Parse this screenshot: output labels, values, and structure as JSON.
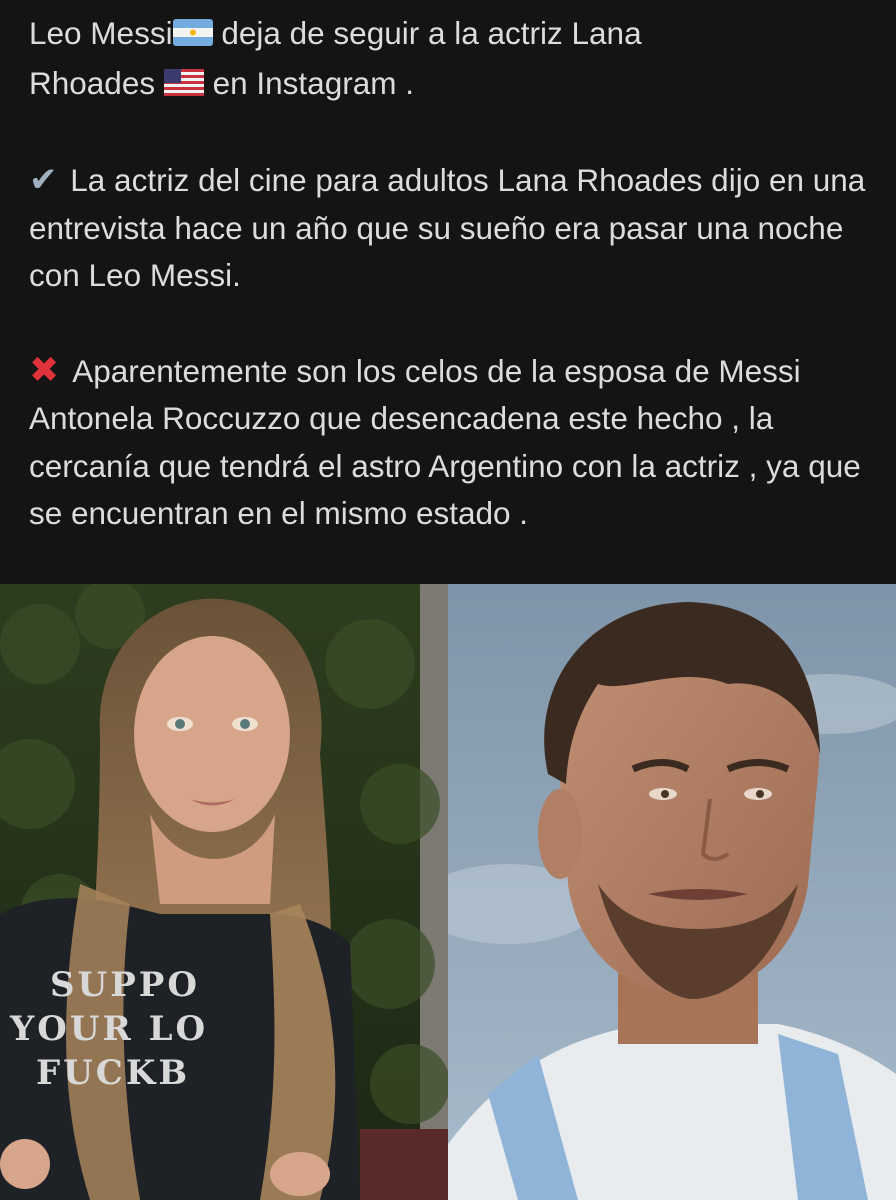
{
  "post": {
    "line1_a": "Leo Messi",
    "line1_b": " deja de seguir a la actriz Lana",
    "line2_a": "Rhoades ",
    "line2_b": " en Instagram .",
    "para2": "La actriz del cine para adultos Lana Rhoades dijo en una entrevista hace un año que su sueño era pasar una noche con Leo Messi.",
    "para3": "Aparentemente son los celos de la esposa de Messi Antonela Roccuzzo que desencadena este hecho , la cercanía que tendrá el astro Argentino con la actriz , ya que se encuentran en el mismo estado .",
    "check_icon": "✔",
    "cross_icon": "✖",
    "flag_1": "argentina-flag-icon",
    "flag_2": "usa-flag-icon"
  },
  "images": {
    "left_shirt_line1": "SUPPO",
    "left_shirt_line2": "YOUR LO",
    "left_shirt_line3": "FUCKB"
  },
  "colors": {
    "background": "#141414",
    "text": "#dcdcdc",
    "cross": "#e0323a",
    "check": "#9fb0c0"
  }
}
